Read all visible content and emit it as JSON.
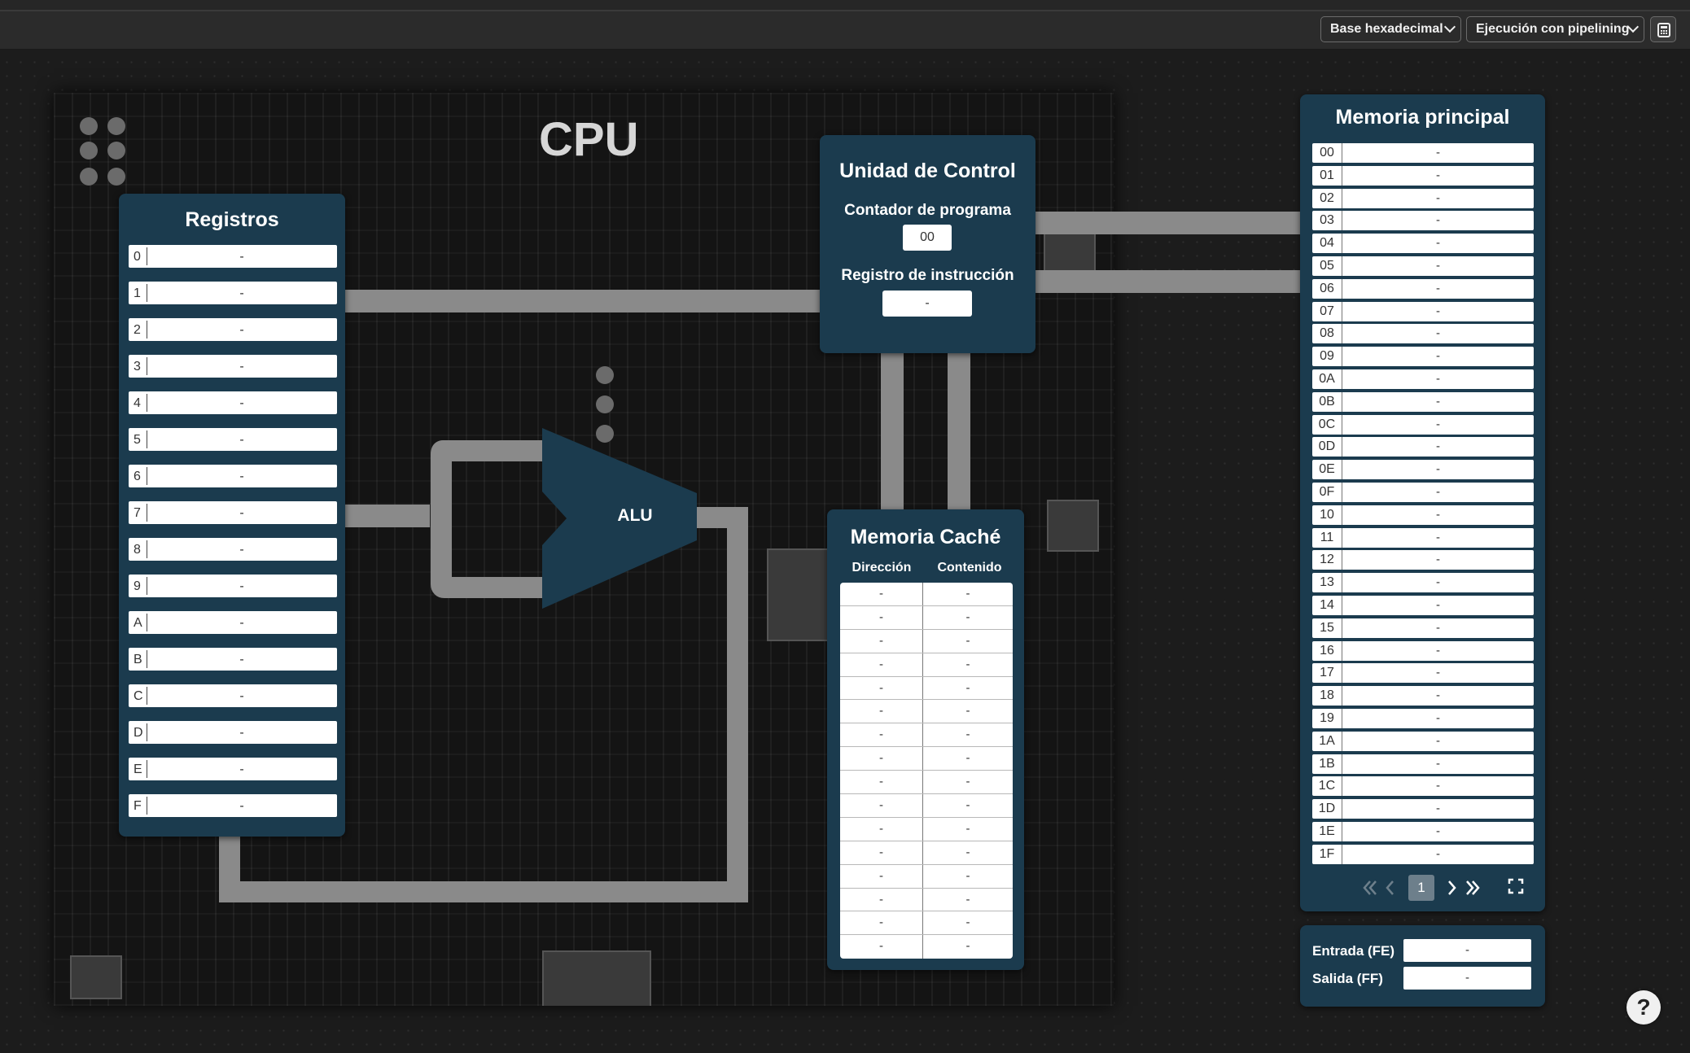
{
  "toolbar": {
    "base_select": "Base hexadecimal",
    "mode_select": "Ejecución con pipelining"
  },
  "cpu": {
    "title": "CPU"
  },
  "registers": {
    "title": "Registros",
    "items": [
      {
        "index": "0",
        "value": "-"
      },
      {
        "index": "1",
        "value": "-"
      },
      {
        "index": "2",
        "value": "-"
      },
      {
        "index": "3",
        "value": "-"
      },
      {
        "index": "4",
        "value": "-"
      },
      {
        "index": "5",
        "value": "-"
      },
      {
        "index": "6",
        "value": "-"
      },
      {
        "index": "7",
        "value": "-"
      },
      {
        "index": "8",
        "value": "-"
      },
      {
        "index": "9",
        "value": "-"
      },
      {
        "index": "A",
        "value": "-"
      },
      {
        "index": "B",
        "value": "-"
      },
      {
        "index": "C",
        "value": "-"
      },
      {
        "index": "D",
        "value": "-"
      },
      {
        "index": "E",
        "value": "-"
      },
      {
        "index": "F",
        "value": "-"
      }
    ]
  },
  "control_unit": {
    "title": "Unidad de Control",
    "pc_label": "Contador de programa",
    "pc_value": "00",
    "ir_label": "Registro de instrucción",
    "ir_value": "-"
  },
  "alu": {
    "label": "ALU"
  },
  "cache": {
    "title": "Memoria Caché",
    "col_address": "Dirección",
    "col_content": "Contenido",
    "rows": [
      {
        "address": "-",
        "content": "-"
      },
      {
        "address": "-",
        "content": "-"
      },
      {
        "address": "-",
        "content": "-"
      },
      {
        "address": "-",
        "content": "-"
      },
      {
        "address": "-",
        "content": "-"
      },
      {
        "address": "-",
        "content": "-"
      },
      {
        "address": "-",
        "content": "-"
      },
      {
        "address": "-",
        "content": "-"
      },
      {
        "address": "-",
        "content": "-"
      },
      {
        "address": "-",
        "content": "-"
      },
      {
        "address": "-",
        "content": "-"
      },
      {
        "address": "-",
        "content": "-"
      },
      {
        "address": "-",
        "content": "-"
      },
      {
        "address": "-",
        "content": "-"
      },
      {
        "address": "-",
        "content": "-"
      },
      {
        "address": "-",
        "content": "-"
      }
    ]
  },
  "main_memory": {
    "title": "Memoria principal",
    "rows": [
      {
        "address": "00",
        "value": "-"
      },
      {
        "address": "01",
        "value": "-"
      },
      {
        "address": "02",
        "value": "-"
      },
      {
        "address": "03",
        "value": "-"
      },
      {
        "address": "04",
        "value": "-"
      },
      {
        "address": "05",
        "value": "-"
      },
      {
        "address": "06",
        "value": "-"
      },
      {
        "address": "07",
        "value": "-"
      },
      {
        "address": "08",
        "value": "-"
      },
      {
        "address": "09",
        "value": "-"
      },
      {
        "address": "0A",
        "value": "-"
      },
      {
        "address": "0B",
        "value": "-"
      },
      {
        "address": "0C",
        "value": "-"
      },
      {
        "address": "0D",
        "value": "-"
      },
      {
        "address": "0E",
        "value": "-"
      },
      {
        "address": "0F",
        "value": "-"
      },
      {
        "address": "10",
        "value": "-"
      },
      {
        "address": "11",
        "value": "-"
      },
      {
        "address": "12",
        "value": "-"
      },
      {
        "address": "13",
        "value": "-"
      },
      {
        "address": "14",
        "value": "-"
      },
      {
        "address": "15",
        "value": "-"
      },
      {
        "address": "16",
        "value": "-"
      },
      {
        "address": "17",
        "value": "-"
      },
      {
        "address": "18",
        "value": "-"
      },
      {
        "address": "19",
        "value": "-"
      },
      {
        "address": "1A",
        "value": "-"
      },
      {
        "address": "1B",
        "value": "-"
      },
      {
        "address": "1C",
        "value": "-"
      },
      {
        "address": "1D",
        "value": "-"
      },
      {
        "address": "1E",
        "value": "-"
      },
      {
        "address": "1F",
        "value": "-"
      }
    ],
    "page": "1"
  },
  "io": {
    "input_label": "Entrada (FE)",
    "input_value": "-",
    "output_label": "Salida (FF)",
    "output_value": "-"
  },
  "help": {
    "label": "?"
  },
  "colors": {
    "panel": "#1b3b4e",
    "bus": "#8a8a8a",
    "page_active": "#6d7f8b"
  },
  "icons": [
    "calculator-icon",
    "first-page-icon",
    "prev-page-icon",
    "next-page-icon",
    "last-page-icon",
    "fullscreen-icon",
    "help-icon"
  ]
}
